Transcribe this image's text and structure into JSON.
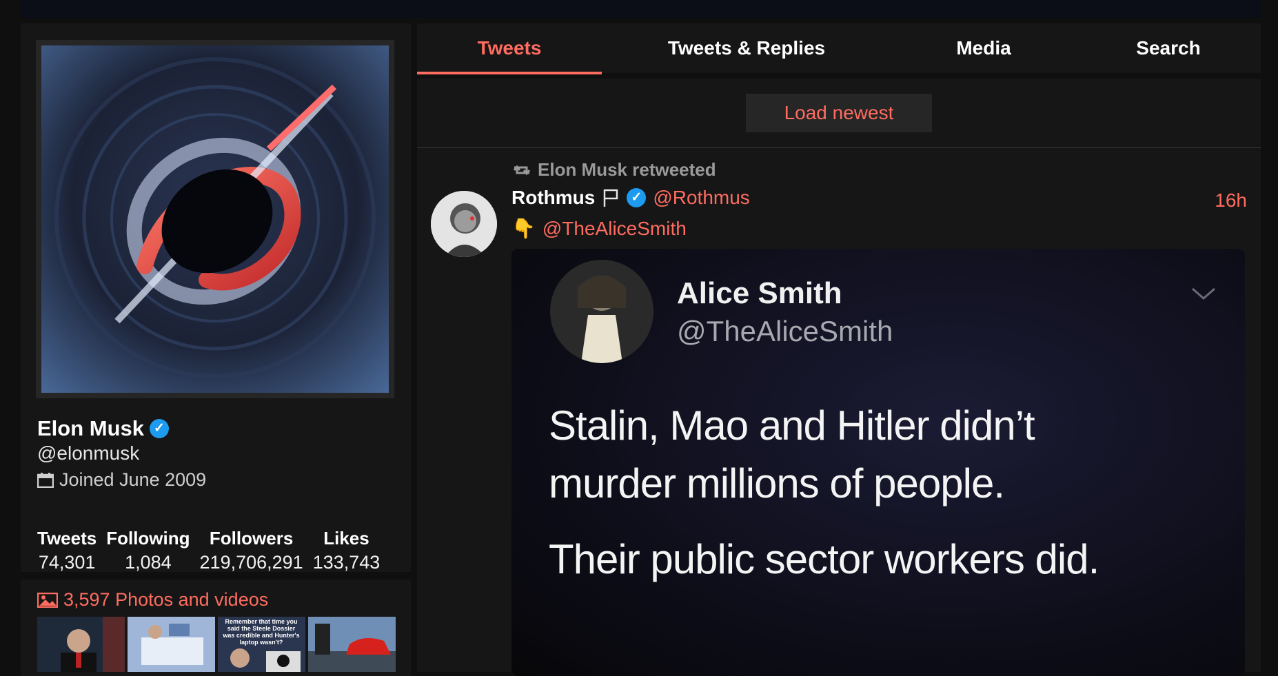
{
  "profile": {
    "name": "Elon Musk",
    "verified_icon": "verified-badge-icon",
    "handle": "@elonmusk",
    "joined": "Joined June 2009",
    "stats": [
      {
        "label": "Tweets",
        "value": "74,301"
      },
      {
        "label": "Following",
        "value": "1,084"
      },
      {
        "label": "Followers",
        "value": "219,706,291"
      },
      {
        "label": "Likes",
        "value": "133,743"
      }
    ]
  },
  "photos": {
    "title": "3,597 Photos and videos",
    "thumb_caption": "Remember that time you said the Steele Dossier was credible and Hunter's laptop wasn't?"
  },
  "tabs": [
    {
      "label": "Tweets",
      "active": true
    },
    {
      "label": "Tweets & Replies",
      "active": false
    },
    {
      "label": "Media",
      "active": false
    },
    {
      "label": "Search",
      "active": false
    }
  ],
  "timeline": {
    "load_newest": "Load newest"
  },
  "tweet": {
    "retweet_text": "Elon Musk retweeted",
    "fullname": "Rothmus",
    "handle": "@Rothmus",
    "date": "16h",
    "emoji": "👇",
    "mention": "@TheAliceSmith",
    "quoted_image": {
      "name": "Alice Smith",
      "handle": "@TheAliceSmith",
      "lines": [
        "Stalin, Mao and Hitler didn’t",
        "murder millions of people.",
        "Their public sector workers did."
      ]
    }
  },
  "colors": {
    "accent": "#ff6c60",
    "background": "#0f0f0f",
    "panel": "#161616",
    "verified": "#1d9bf0"
  }
}
